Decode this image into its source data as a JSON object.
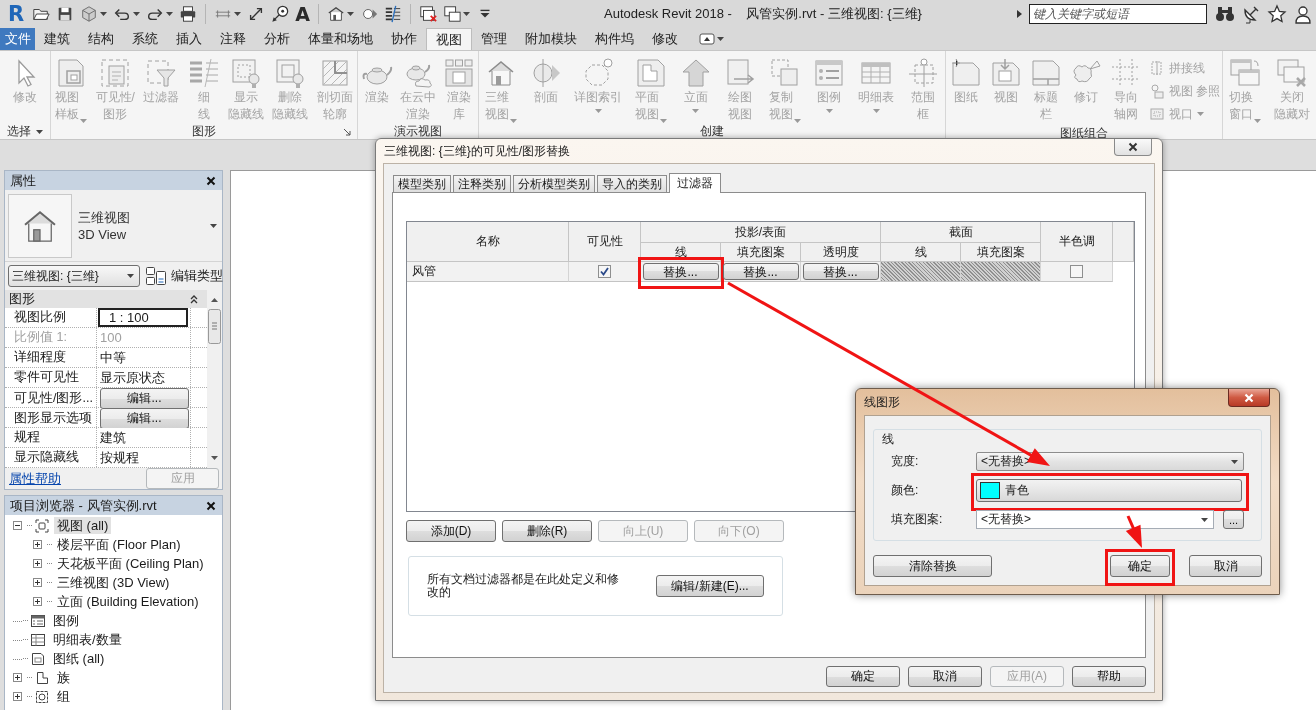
{
  "title_bar": {
    "app_logo": "R",
    "quick_access": [
      {
        "items": [
          {
            "menu": false
          },
          {
            "menu": false
          },
          {
            "menu": true
          },
          {
            "menu": true
          },
          {
            "menu": true
          },
          {
            "menu": false
          }
        ]
      },
      {
        "items": [
          {
            "menu": true
          },
          {
            "menu": false
          },
          {
            "menu": false
          },
          {
            "glyph": "A",
            "menu": false
          }
        ]
      },
      {
        "items": [
          {
            "menu": true
          },
          {
            "menu": false
          },
          {
            "menu": false
          }
        ]
      },
      {
        "items": [
          {
            "menu": false
          },
          {
            "menu": true
          },
          {
            "menu": false
          }
        ]
      }
    ],
    "title": "Autodesk Revit 2018 -    风管实例.rvt - 三维视图: {三维}",
    "search": {
      "placeholder": "键入关键字或短语"
    }
  },
  "ribbon": {
    "tabs": [
      {
        "label": "文件",
        "kind": "application",
        "selected": false
      },
      {
        "label": "建筑",
        "kind": "tab",
        "selected": false
      },
      {
        "label": "结构",
        "kind": "tab",
        "selected": false
      },
      {
        "label": "系统",
        "kind": "tab",
        "selected": false
      },
      {
        "label": "插入",
        "kind": "tab",
        "selected": false
      },
      {
        "label": "注释",
        "kind": "tab",
        "selected": false
      },
      {
        "label": "分析",
        "kind": "tab",
        "selected": false
      },
      {
        "label": "体量和场地",
        "kind": "tab",
        "selected": false
      },
      {
        "label": "协作",
        "kind": "tab",
        "selected": false
      },
      {
        "label": "视图",
        "kind": "tab",
        "selected": true
      },
      {
        "label": "管理",
        "kind": "tab",
        "selected": false
      },
      {
        "label": "附加模块",
        "kind": "tab",
        "selected": false
      },
      {
        "label": "构件坞",
        "kind": "tab",
        "selected": false
      },
      {
        "label": "修改",
        "kind": "tab",
        "selected": false
      }
    ],
    "panels": [
      {
        "title": "选择",
        "menu": true,
        "launcher": false,
        "tools": [
          {
            "lines": [
              "修改"
            ],
            "menu": false
          }
        ]
      },
      {
        "title": "图形",
        "menu": false,
        "launcher": true,
        "tools": [
          {
            "lines": [
              "视图",
              "样板"
            ],
            "menu": true
          },
          {
            "lines": [
              "可见性/",
              "图形"
            ],
            "menu": false
          },
          {
            "lines": [
              "过滤器"
            ],
            "menu": false
          },
          {
            "lines": [
              "细",
              "线"
            ],
            "menu": false
          },
          {
            "lines": [
              "显示",
              "隐藏线"
            ],
            "menu": false
          },
          {
            "lines": [
              "删除",
              "隐藏线"
            ],
            "menu": false
          },
          {
            "lines": [
              "剖切面",
              "轮廓"
            ],
            "menu": false
          }
        ]
      },
      {
        "title": "演示视图",
        "menu": false,
        "launcher": false,
        "tools": [
          {
            "lines": [
              "渲染"
            ],
            "menu": false
          },
          {
            "lines": [
              "在云中",
              "渲染"
            ],
            "menu": false
          },
          {
            "lines": [
              "渲染",
              "库"
            ],
            "menu": false
          }
        ]
      },
      {
        "title": "创建",
        "menu": false,
        "launcher": false,
        "tools": [
          {
            "lines": [
              "三维",
              "视图"
            ],
            "menu": true
          },
          {
            "lines": [
              "剖面"
            ],
            "menu": false
          },
          {
            "lines": [
              "详图索引"
            ],
            "menu": true
          },
          {
            "lines": [
              "平面",
              "视图"
            ],
            "menu": true
          },
          {
            "lines": [
              "立面"
            ],
            "menu": true
          },
          {
            "lines": [
              "绘图",
              "视图"
            ],
            "menu": false
          },
          {
            "lines": [
              "复制",
              "视图"
            ],
            "menu": true
          },
          {
            "lines": [
              "图例"
            ],
            "menu": true
          },
          {
            "lines": [
              "明细表"
            ],
            "menu": true
          },
          {
            "lines": [
              "范围",
              "框"
            ],
            "menu": false
          }
        ]
      },
      {
        "title": "图纸组合",
        "menu": false,
        "launcher": false,
        "tools": [
          {
            "lines": [
              "图纸"
            ],
            "menu": false
          },
          {
            "lines": [
              "视图"
            ],
            "menu": false
          },
          {
            "lines": [
              "标题",
              "栏"
            ],
            "menu": false
          },
          {
            "lines": [
              "修订"
            ],
            "menu": false
          },
          {
            "lines": [
              "导向",
              "轴网"
            ],
            "menu": false
          }
        ],
        "small_tools": [
          {
            "label": "拼接线",
            "menu": false
          },
          {
            "label": "视图 参照",
            "menu": false
          },
          {
            "label": "视口",
            "menu": true
          }
        ]
      },
      {
        "tools": [
          {
            "lines": [
              "切换",
              "窗口"
            ],
            "menu": true
          },
          {
            "lines": [
              "关闭",
              "隐藏对"
            ],
            "menu": false
          }
        ]
      }
    ]
  },
  "properties": {
    "title": "属性",
    "type_name": "三维视图",
    "type_name_en": "3D View",
    "instance_selector": "三维视图: {三维}",
    "edit_type": "编辑类型",
    "group": "图形",
    "rows": [
      {
        "name": "视图比例",
        "value": "1 : 100",
        "kind": "input"
      },
      {
        "name": "比例值 1:",
        "value": "100",
        "kind": "readonly"
      },
      {
        "name": "详细程度",
        "value": "中等",
        "kind": "text"
      },
      {
        "name": "零件可见性",
        "value": "显示原状态",
        "kind": "text"
      },
      {
        "name": "可见性/图形...",
        "value": "编辑...",
        "kind": "button"
      },
      {
        "name": "图形显示选项",
        "value": "编辑...",
        "kind": "button"
      },
      {
        "name": "规程",
        "value": "建筑",
        "kind": "text"
      },
      {
        "name": "显示隐藏线",
        "value": "按规程",
        "kind": "text"
      }
    ],
    "help_link": "属性帮助",
    "apply_button": {
      "label": "应用",
      "disabled": true
    }
  },
  "project_browser": {
    "title": "项目浏览器 - 风管实例.rvt",
    "tree": [
      {
        "label": "视图 (all)",
        "expanded": true,
        "selected": true,
        "children": [
          {
            "label": "楼层平面 (Floor Plan)",
            "expanded": false,
            "selected": false
          },
          {
            "label": "天花板平面 (Ceiling Plan)",
            "expanded": false,
            "selected": false
          },
          {
            "label": "三维视图 (3D View)",
            "expanded": false,
            "selected": false
          },
          {
            "label": "立面 (Building Elevation)",
            "expanded": false,
            "selected": false
          }
        ]
      },
      {
        "label": "图例",
        "selected": false
      },
      {
        "label": "明细表/数量",
        "selected": false
      },
      {
        "label": "图纸 (all)",
        "selected": false
      },
      {
        "label": "族",
        "expanded": false,
        "selected": false
      },
      {
        "label": "组",
        "expanded": false,
        "selected": false
      }
    ]
  },
  "vg_dialog": {
    "title": "三维视图: {三维}的可见性/图形替换",
    "tabs": [
      {
        "label": "模型类别",
        "selected": false
      },
      {
        "label": "注释类别",
        "selected": false
      },
      {
        "label": "分析模型类别",
        "selected": false
      },
      {
        "label": "导入的类别",
        "selected": false
      },
      {
        "label": "过滤器",
        "selected": true
      }
    ],
    "table": {
      "columns": [
        {
          "label": "名称"
        },
        {
          "label": "可见性"
        },
        {
          "label": "线",
          "group": "投影/表面"
        },
        {
          "label": "填充图案",
          "grouped": true
        },
        {
          "label": "透明度",
          "grouped": true
        },
        {
          "label": "线",
          "group": "截面"
        },
        {
          "label": "填充图案",
          "grouped": true
        },
        {
          "label": "半色调"
        }
      ],
      "rows": [
        {
          "cells": [
            {
              "kind": "text",
              "text": "风管"
            },
            {
              "kind": "checkbox",
              "checked": true
            },
            {
              "kind": "button",
              "label": "替换...",
              "highlighted": true
            },
            {
              "kind": "button",
              "label": "替换...",
              "highlighted": false
            },
            {
              "kind": "button",
              "label": "替换...",
              "highlighted": false
            },
            {
              "kind": "hatched"
            },
            {
              "kind": "hatched"
            },
            {
              "kind": "checkbox",
              "checked": false
            }
          ]
        }
      ]
    },
    "buttons": [
      {
        "label": "添加(D)",
        "disabled": false
      },
      {
        "label": "删除(R)",
        "disabled": false
      },
      {
        "label": "向上(U)",
        "disabled": true
      },
      {
        "label": "向下(O)",
        "disabled": true
      }
    ],
    "info": {
      "text": "所有文档过滤器都是在此处定义和修改的",
      "button": "编辑/新建(E)..."
    },
    "footer_buttons": [
      {
        "label": "确定",
        "disabled": false
      },
      {
        "label": "取消",
        "disabled": false
      },
      {
        "label": "应用(A)",
        "disabled": true
      },
      {
        "label": "帮助",
        "disabled": false
      }
    ]
  },
  "line_dialog": {
    "title": "线图形",
    "group": "线",
    "fields": [
      {
        "label": "宽度:",
        "kind": "dropdown",
        "value": "<无替换>",
        "highlighted": false
      },
      {
        "label": "颜色:",
        "kind": "color",
        "value": "青色",
        "color": "#00ffff",
        "highlighted": true
      },
      {
        "label": "填充图案:",
        "kind": "dropdown_browse",
        "value": "<无替换>",
        "browse": "...",
        "highlighted": false
      }
    ],
    "buttons": [
      {
        "label": "清除替换",
        "highlighted": false
      },
      {
        "label": "确定",
        "highlighted": true
      },
      {
        "label": "取消",
        "highlighted": false
      }
    ]
  }
}
